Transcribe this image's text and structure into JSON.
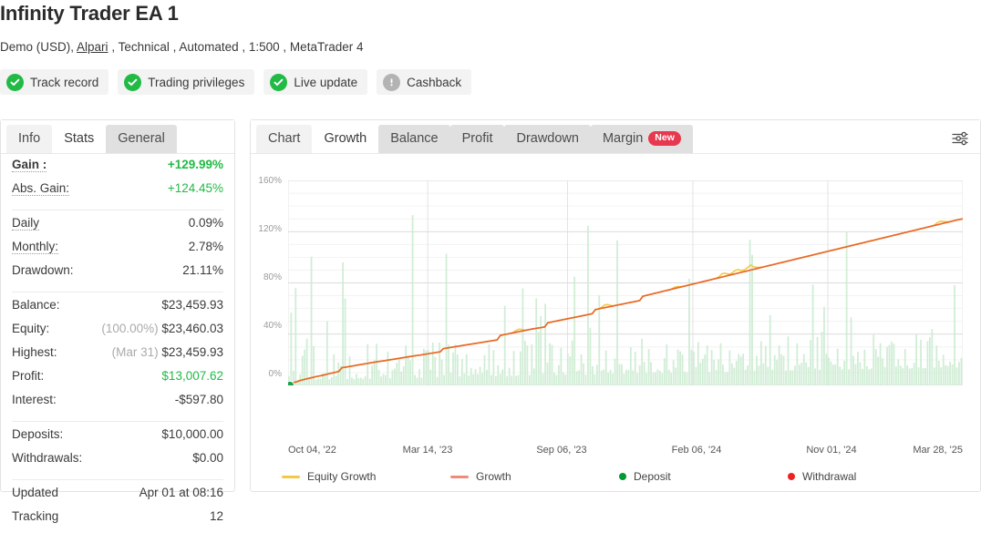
{
  "header": {
    "title": "Infinity Trader EA 1",
    "subtitle_parts": [
      "Demo (USD),",
      "Alpari",
      ", Technical , Automated , 1:500 , MetaTrader 4"
    ],
    "broker_link": "Alpari",
    "badges": [
      {
        "label": "Track record",
        "icon": "check-circle-icon",
        "state": "ok"
      },
      {
        "label": "Trading privileges",
        "icon": "check-circle-icon",
        "state": "ok"
      },
      {
        "label": "Live update",
        "icon": "check-circle-icon",
        "state": "ok"
      },
      {
        "label": "Cashback",
        "icon": "exclamation-circle-icon",
        "state": "off"
      }
    ],
    "colors": {
      "ok": "#21ba45",
      "off": "#b3b3b3"
    }
  },
  "left_panel": {
    "tabs": [
      {
        "label": "Info",
        "active": false
      },
      {
        "label": "Stats",
        "active": true
      },
      {
        "label": "General",
        "active": false
      }
    ],
    "groups": [
      {
        "rows": [
          {
            "key": "Gain :",
            "value": "+129.99%",
            "key_style": "dotted",
            "value_style": "green-bold"
          },
          {
            "key": "Abs. Gain:",
            "value": "+124.45%",
            "key_style": "dotted",
            "value_style": "green"
          }
        ]
      },
      {
        "rows": [
          {
            "key": "Daily",
            "value": "0.09%",
            "key_style": "dotted",
            "value_style": "plain"
          },
          {
            "key": "Monthly:",
            "value": "2.78%",
            "key_style": "dotted",
            "value_style": "plain"
          },
          {
            "key": "Drawdown:",
            "value": "21.11%",
            "key_style": "none",
            "value_style": "plain"
          }
        ]
      },
      {
        "rows": [
          {
            "key": "Balance:",
            "value": "$23,459.93",
            "key_style": "none",
            "value_style": "plain"
          },
          {
            "key": "Equity:",
            "value": "$23,460.03",
            "prefix": "(100.00%)",
            "key_style": "none",
            "value_style": "plain"
          },
          {
            "key": "Highest:",
            "value": "$23,459.93",
            "prefix": "(Mar 31)",
            "key_style": "none",
            "value_style": "plain"
          },
          {
            "key": "Profit:",
            "value": "$13,007.62",
            "key_style": "none",
            "value_style": "green"
          },
          {
            "key": "Interest:",
            "value": "-$597.80",
            "key_style": "none",
            "value_style": "plain"
          }
        ]
      },
      {
        "rows": [
          {
            "key": "Deposits:",
            "value": "$10,000.00",
            "key_style": "none",
            "value_style": "plain"
          },
          {
            "key": "Withdrawals:",
            "value": "$0.00",
            "key_style": "none",
            "value_style": "plain"
          }
        ]
      },
      {
        "rows": [
          {
            "key": "Updated",
            "value": "Apr 01 at 08:16",
            "key_style": "none",
            "value_style": "plain"
          },
          {
            "key": "Tracking",
            "value": "12",
            "key_style": "none",
            "value_style": "plain"
          }
        ]
      }
    ]
  },
  "right_panel": {
    "tabs": [
      {
        "label": "Chart",
        "active": false
      },
      {
        "label": "Growth",
        "active": true
      },
      {
        "label": "Balance",
        "active": false
      },
      {
        "label": "Profit",
        "active": false
      },
      {
        "label": "Drawdown",
        "active": false
      },
      {
        "label": "Margin",
        "active": false,
        "badge": "New"
      }
    ],
    "settings_icon": "sliders-icon"
  },
  "chart_data": {
    "type": "line",
    "title": "Growth",
    "xlabel": "",
    "ylabel": "",
    "ylim": [
      0,
      160
    ],
    "yticks": [
      0,
      40,
      80,
      120,
      160
    ],
    "ytick_labels": [
      "0%",
      "40%",
      "80%",
      "120%",
      "160%"
    ],
    "xtick_labels": [
      "Oct 04, '22",
      "Mar 14, '23",
      "Sep 06, '23",
      "Feb 06, '24",
      "Nov 01, '24",
      "Mar 28, '25"
    ],
    "xtick_positions": [
      0.0,
      0.207,
      0.414,
      0.6,
      0.8,
      0.985
    ],
    "grid": true,
    "legend": [
      {
        "name": "Equity Growth",
        "color": "#f5c842",
        "marker": "line"
      },
      {
        "name": "Growth",
        "color": "#f08a7a",
        "marker": "line"
      },
      {
        "name": "Deposit",
        "color": "#009933",
        "marker": "dot"
      },
      {
        "name": "Withdrawal",
        "color": "#ee2222",
        "marker": "dot"
      }
    ],
    "series": [
      {
        "name": "Growth",
        "color": "#e8682a",
        "values": [
          0,
          1.2,
          2.4,
          3.1,
          4.0,
          4.6,
          5.2,
          5.8,
          6.3,
          7.0,
          7.4,
          7.9,
          8.6,
          9.2,
          9.7,
          10.3,
          10.9,
          13.8,
          14.2,
          14.6,
          15.0,
          15.4,
          15.9,
          16.3,
          16.7,
          17.1,
          17.6,
          18.0,
          18.4,
          18.8,
          19.1,
          19.5,
          19.9,
          20.3,
          20.7,
          21.1,
          21.5,
          21.9,
          22.3,
          22.7,
          23.1,
          23.4,
          23.8,
          24.2,
          24.6,
          25.0,
          25.4,
          25.8,
          26.2,
          28.7,
          29.1,
          29.5,
          29.9,
          30.3,
          30.7,
          31.1,
          31.5,
          31.9,
          32.3,
          32.7,
          33.1,
          33.5,
          33.9,
          34.3,
          34.7,
          35.1,
          35.5,
          39.0,
          39.5,
          40.0,
          40.5,
          41.0,
          41.5,
          42.0,
          42.5,
          43.0,
          43.5,
          44.0,
          44.4,
          44.8,
          45.2,
          45.6,
          48.9,
          49.4,
          49.9,
          50.4,
          50.9,
          51.4,
          51.9,
          52.4,
          52.9,
          53.4,
          53.9,
          54.4,
          54.9,
          55.4,
          55.9,
          59.1,
          59.7,
          60.2,
          60.7,
          61.2,
          61.7,
          62.2,
          62.7,
          63.2,
          63.7,
          64.2,
          64.7,
          65.2,
          65.7,
          66.2,
          69.6,
          70.2,
          70.8,
          71.4,
          72.0,
          72.6,
          73.2,
          73.8,
          74.4,
          75.0,
          75.6,
          76.2,
          76.8,
          77.4,
          78.0,
          78.6,
          79.2,
          79.8,
          80.4,
          81.0,
          81.6,
          82.2,
          82.8,
          83.4,
          84.0,
          84.6,
          85.2,
          85.8,
          86.4,
          87.0,
          87.6,
          88.2,
          88.8,
          89.4,
          90.0,
          90.6,
          91.2,
          91.8,
          92.4,
          93.0,
          93.6,
          94.2,
          94.8,
          95.4,
          96.0,
          96.6,
          97.2,
          97.8,
          98.4,
          99.0,
          99.6,
          100.2,
          100.8,
          101.4,
          102.0,
          102.6,
          103.2,
          103.8,
          104.4,
          105.0,
          105.6,
          106.2,
          106.8,
          107.4,
          108.0,
          108.6,
          109.2,
          109.8,
          110.4,
          111.0,
          111.6,
          112.2,
          112.8,
          113.4,
          114.0,
          114.6,
          115.2,
          115.8,
          116.4,
          117.0,
          117.6,
          118.2,
          118.8,
          119.4,
          120.0,
          120.6,
          121.2,
          121.8,
          122.4,
          123.0,
          123.6,
          124.2,
          124.8,
          125.4,
          126.0,
          126.6,
          127.2,
          127.8,
          128.4,
          129.0,
          129.5,
          129.99
        ]
      },
      {
        "name": "Equity Growth",
        "color": "#f5c842",
        "note": "Shadows the Growth line, with intraday dips visible near Feb 2024 and Mar 2025"
      }
    ],
    "markers": [
      {
        "type": "deposit",
        "x": 0.0,
        "y": 0,
        "color": "#009933",
        "label": "Deposit"
      }
    ],
    "bars": {
      "name": "Trade volume",
      "color": "#cdecd3",
      "note": "Dense semi-transparent green vertical bars behind the growth line, heights ranging 2%-135%"
    }
  }
}
